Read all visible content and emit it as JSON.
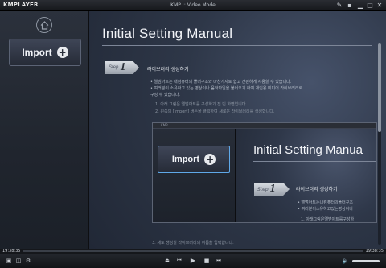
{
  "window": {
    "brand": "KMPLAYER",
    "title": "KMP :: Video Mode",
    "controls": [
      "pin-icon",
      "skin-icon",
      "minimize-icon",
      "maximize-icon",
      "close-icon"
    ]
  },
  "sidebar": {
    "home_icon": "home-icon",
    "import_label": "Import"
  },
  "manual": {
    "title": "Initial Setting Manual",
    "step_word": "Step",
    "step_number": "1",
    "step_title": "라이브러리 생성하기",
    "lines": [
      "• 앨범아트는 내컴퓨터의 폴더구조와 마찬가지로 쉽고 간편하게 사용할 수 있습니다.",
      "• 여러분이 소유하고 있는 영상이나 음악파일을 불러오기 하여 개인용 미디어 라이브러리로",
      "  구성 수 있습니다.",
      "1. 아래 그림은 앨범아트를 구성하기 전 빈 화면입니다.",
      "2. 왼쪽의 [Import] 버튼을 클릭하여 새로운 라이브러리를 생성합니다."
    ],
    "bottom_line": "3. 새로 생성할 라이브러리의 이름을 입력합니다."
  },
  "embedded": {
    "bar_label": "KMP",
    "import_label": "Import",
    "title": "Initial Setting Manua",
    "step_word": "Step",
    "step_number": "1",
    "step_title": "라이브러리 생성하기",
    "lines": [
      "• 앨범아트는내컴퓨터의폴더구조",
      "• 여러분이소유하고있는영상이나",
      "1. 아래그림은앨범아트를구성하"
    ]
  },
  "player": {
    "time_left": "19:38:35",
    "time_right": "19:38:35",
    "volume_percent": 100
  },
  "icons": {
    "play": "play-icon",
    "stop": "stop-icon",
    "prev": "prev-icon",
    "next": "next-icon",
    "eject": "eject-icon"
  },
  "colors": {
    "accent": "#5fa8e8",
    "background": "#212836"
  }
}
